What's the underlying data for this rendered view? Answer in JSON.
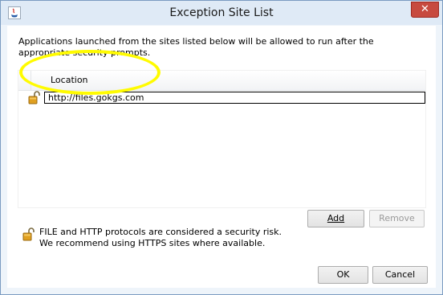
{
  "window": {
    "title": "Exception Site List",
    "close_symbol": "✕"
  },
  "description": "Applications launched from the sites listed below will be allowed to run after the appropriate security prompts.",
  "table": {
    "column_header": "Location",
    "rows": [
      {
        "url": "http://files.gokgs.com"
      }
    ]
  },
  "buttons": {
    "add": "Add",
    "remove": "Remove",
    "ok": "OK",
    "cancel": "Cancel"
  },
  "warning": {
    "line1": "FILE and HTTP protocols are considered a security risk.",
    "line2": "We recommend using HTTPS sites where available."
  },
  "colors": {
    "highlight": "#fffb00",
    "close_button": "#c74a3f",
    "lock": "#e0a020"
  }
}
